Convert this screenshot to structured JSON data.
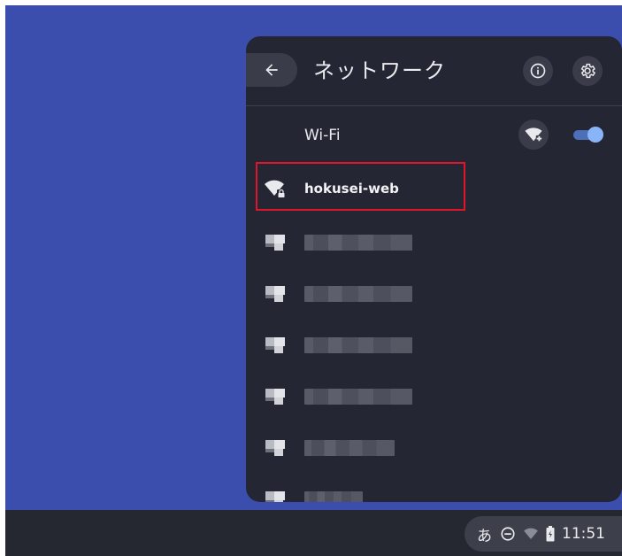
{
  "panel": {
    "title": "ネットワーク",
    "wifi_label": "Wi-Fi",
    "wifi_enabled": true
  },
  "networks": [
    {
      "name": "hokusei-web",
      "secured": true,
      "highlighted": true
    },
    {
      "name": "",
      "obscured": true
    },
    {
      "name": "",
      "obscured": true
    },
    {
      "name": "",
      "obscured": true
    },
    {
      "name": "",
      "obscured": true
    },
    {
      "name": "",
      "obscured": true
    },
    {
      "name": "",
      "obscured": true
    }
  ],
  "status_tray": {
    "ime_indicator": "あ",
    "time": "11:51"
  },
  "icons": {
    "back": "arrow-back-icon",
    "info": "info-icon",
    "settings": "gear-icon",
    "add_wifi": "wifi-add-icon",
    "dnd": "do-not-disturb-icon",
    "wifi": "wifi-icon",
    "battery": "battery-icon"
  },
  "colors": {
    "desktop": "#3c4ead",
    "panel": "#242633",
    "accent": "#8ab4f8",
    "highlight": "#e0142a"
  }
}
